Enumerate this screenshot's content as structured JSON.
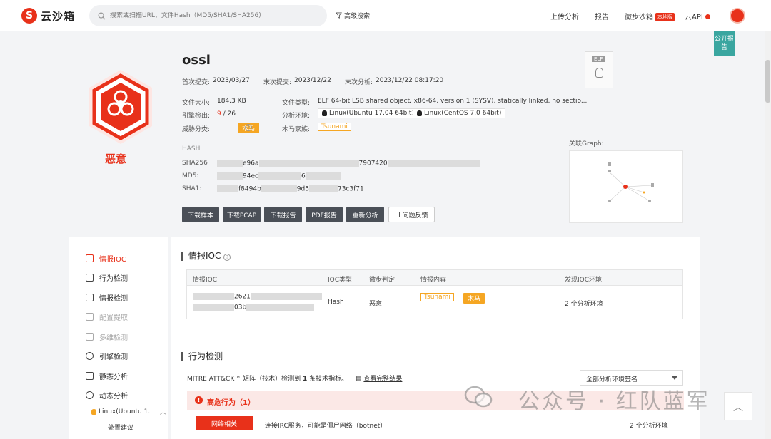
{
  "header": {
    "logo_text": "云沙箱",
    "search_placeholder": "搜索或扫描URL、文件Hash（MD5/SHA1/SHA256）",
    "advanced_search": "高级搜索",
    "nav": {
      "upload": "上传分析",
      "report": "报告",
      "local_sandbox": "微步沙箱",
      "local_badge": "本地版",
      "cloud_api": "云API"
    },
    "public_report": "公开报告"
  },
  "file": {
    "verdict": "恶意",
    "name": "ossl",
    "first_submit_label": "首次提交:",
    "first_submit": "2023/03/27",
    "last_submit_label": "末次提交:",
    "last_submit": "2023/12/22",
    "last_analysis_label": "末次分析:",
    "last_analysis": "2023/12/22 08:17:20",
    "size_label": "文件大小:",
    "size": "184.3 KB",
    "type_label": "文件类型:",
    "type": "ELF 64-bit LSB shared object, x86-64, version 1 (SYSV), statically linked, no sectio...",
    "engine_label": "引擎检出:",
    "engine_hits": "9",
    "engine_total": "/ 26",
    "env_label": "分析环境:",
    "env1": "Linux(Ubuntu 17.04 64bit)",
    "env2": "Linux(CentOS 7.0 64bit)",
    "threat_label": "威胁分类:",
    "threat": "木马",
    "family_label": "木马家族:",
    "family": "Tsunami",
    "hash_label": "HASH",
    "sha256_label": "SHA256",
    "sha256_a": "e96a",
    "sha256_b": "7907420",
    "md5_label": "MD5:",
    "md5_a": "94ec",
    "md5_b": "6",
    "sha1_label": "SHA1:",
    "sha1_a": "f8494b",
    "sha1_b": "9d5",
    "sha1_c": "73c3f71",
    "elf_label": "ELF",
    "graph_label": "关联Graph:"
  },
  "actions": [
    "下载样本",
    "下载PCAP",
    "下载报告",
    "PDF报告",
    "重新分析",
    "问题反馈"
  ],
  "sidebar": {
    "items": [
      {
        "label": "情报IOC"
      },
      {
        "label": "行为检测"
      },
      {
        "label": "情报检测"
      },
      {
        "label": "配置提取"
      },
      {
        "label": "多维检测"
      },
      {
        "label": "引擎检测"
      },
      {
        "label": "静态分析"
      },
      {
        "label": "动态分析"
      }
    ],
    "sub_env": "Linux(Ubuntu 1...",
    "sub_item": "处置建议"
  },
  "ioc": {
    "title": "情报IOC",
    "columns": [
      "情报IOC",
      "IOC类型",
      "微步判定",
      "情报内容",
      "发现IOC环境"
    ],
    "row": {
      "ioc_a": "2621",
      "ioc_b": "03b",
      "type": "Hash",
      "verdict": "恶意",
      "tag1": "Tsunami",
      "tag2": "木马",
      "env": "2 个分析环境"
    }
  },
  "behavior": {
    "title": "行为检测",
    "mitre_pre": "MITRE ATT&CK™ 矩阵（技术）检测到",
    "mitre_count": "1",
    "mitre_post": "条技术指标。",
    "view_all": "查看完整结果",
    "select": "全部分析环境签名",
    "high_risk": "高危行为（1）",
    "net_button": "网络相关",
    "net_desc": "连接IRC服务，可能是僵尸网络（botnet）",
    "net_env": "2 个分析环境"
  },
  "watermark": "公众号 · 红队蓝军",
  "colors": {
    "accent": "#e8311a",
    "orange": "#f5a623",
    "teal": "#3aa6a0"
  }
}
